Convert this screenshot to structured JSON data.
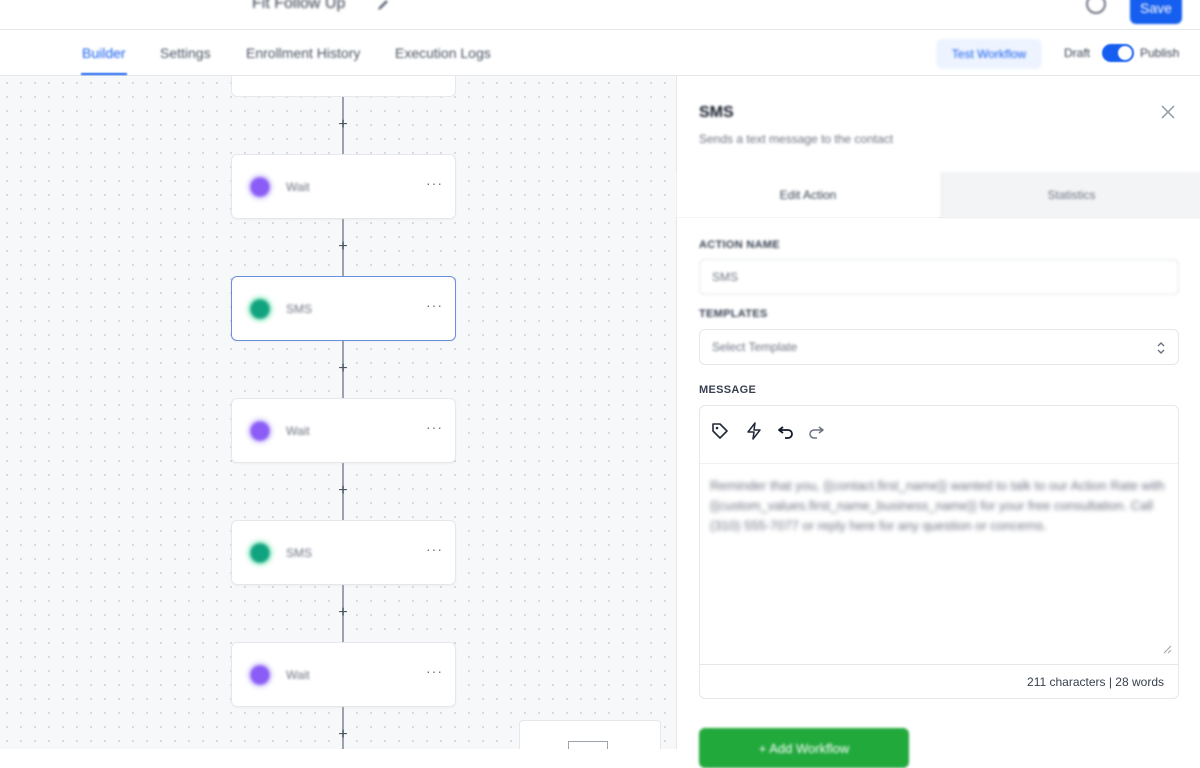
{
  "header": {
    "workflow_title": "Fit Follow Up",
    "save_label": "Save"
  },
  "tabs": [
    {
      "label": "Builder"
    },
    {
      "label": "Settings"
    },
    {
      "label": "Enrollment History"
    },
    {
      "label": "Execution Logs"
    }
  ],
  "toolbar": {
    "test_label": "Test Workflow",
    "draft_label": "Draft",
    "publish_label": "Publish"
  },
  "canvas": {
    "nodes": [
      {
        "type": "wait",
        "label": "Wait"
      },
      {
        "type": "sms",
        "label": "SMS"
      },
      {
        "type": "wait",
        "label": "Wait"
      },
      {
        "type": "sms",
        "label": "SMS"
      },
      {
        "type": "wait",
        "label": "Wait"
      }
    ],
    "plus_symbol": "+",
    "menu_symbol": "···"
  },
  "panel": {
    "title": "SMS",
    "subtitle": "Sends a text message to the contact",
    "tab_edit": "Edit Action",
    "tab_stats": "Statistics",
    "action_name_label": "ACTION NAME",
    "action_name_value": "SMS",
    "template_label": "TEMPLATES",
    "template_placeholder": "Select Template",
    "message_label": "MESSAGE",
    "message_body": "Reminder that you, {{contact.first_name}} wanted to talk to our Action Rate with {{custom_values.first_name_business_name}} for your free consultation. Call (310) 555-7077 or reply here for any question or concerns.",
    "counter": "211 characters | 28 words",
    "add_button": "+ Add Workflow"
  },
  "colors": {
    "accent": "#155eef",
    "wait_purple": "#8b5cf6",
    "sms_green": "#10a37f",
    "add_green": "#22a93c"
  }
}
